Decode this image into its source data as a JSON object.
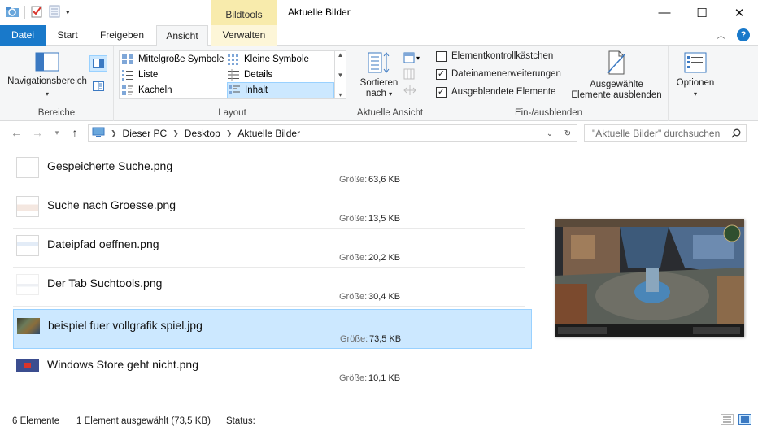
{
  "window": {
    "title": "Aktuelle Bilder",
    "context_tab_group": "Bildtools",
    "minimize": "—",
    "maximize": "☐",
    "close": "✕"
  },
  "tabs": {
    "file": "Datei",
    "start": "Start",
    "share": "Freigeben",
    "view": "Ansicht",
    "manage": "Verwalten",
    "help": "?"
  },
  "ribbon": {
    "panes": {
      "nav_pane": "Navigationsbereich",
      "label": "Bereiche"
    },
    "layout": {
      "items": [
        "Mittelgroße Symbole",
        "Kleine Symbole",
        "Liste",
        "Details",
        "Kacheln",
        "Inhalt"
      ],
      "selected": "Inhalt",
      "label": "Layout"
    },
    "current_view": {
      "sort_line1": "Sortieren",
      "sort_line2": "nach",
      "label": "Aktuelle Ansicht"
    },
    "show_hide": {
      "item_checkboxes": "Elementkontrollkästchen",
      "item_checkboxes_checked": false,
      "file_extensions": "Dateinamenerweiterungen",
      "file_extensions_checked": true,
      "hidden_items": "Ausgeblendete Elemente",
      "hidden_items_checked": true,
      "hide_selected_line1": "Ausgewählte",
      "hide_selected_line2": "Elemente ausblenden",
      "label": "Ein-/ausblenden"
    },
    "options": {
      "label": "Optionen"
    }
  },
  "address": {
    "crumbs": [
      "Dieser PC",
      "Desktop",
      "Aktuelle Bilder"
    ],
    "search_placeholder": "\"Aktuelle Bilder\" durchsuchen"
  },
  "files": [
    {
      "name": "Gespeicherte Suche.png",
      "size_label": "Größe:",
      "size": "63,6 KB",
      "selected": false
    },
    {
      "name": "Suche nach Groesse.png",
      "size_label": "Größe:",
      "size": "13,5 KB",
      "selected": false
    },
    {
      "name": "Dateipfad oeffnen.png",
      "size_label": "Größe:",
      "size": "20,2 KB",
      "selected": false
    },
    {
      "name": "Der Tab Suchtools.png",
      "size_label": "Größe:",
      "size": "30,4 KB",
      "selected": false
    },
    {
      "name": "beispiel fuer vollgrafik spiel.jpg",
      "size_label": "Größe:",
      "size": "73,5 KB",
      "selected": true
    },
    {
      "name": "Windows Store geht nicht.png",
      "size_label": "Größe:",
      "size": "10,1 KB",
      "selected": false
    }
  ],
  "status": {
    "count": "6 Elemente",
    "selection": "1 Element ausgewählt (73,5 KB)",
    "state": "Status:"
  },
  "colors": {
    "accent": "#1979ca",
    "selection_bg": "#cce8ff",
    "selection_border": "#99d1ff",
    "context_tab": "#f8ebac"
  }
}
